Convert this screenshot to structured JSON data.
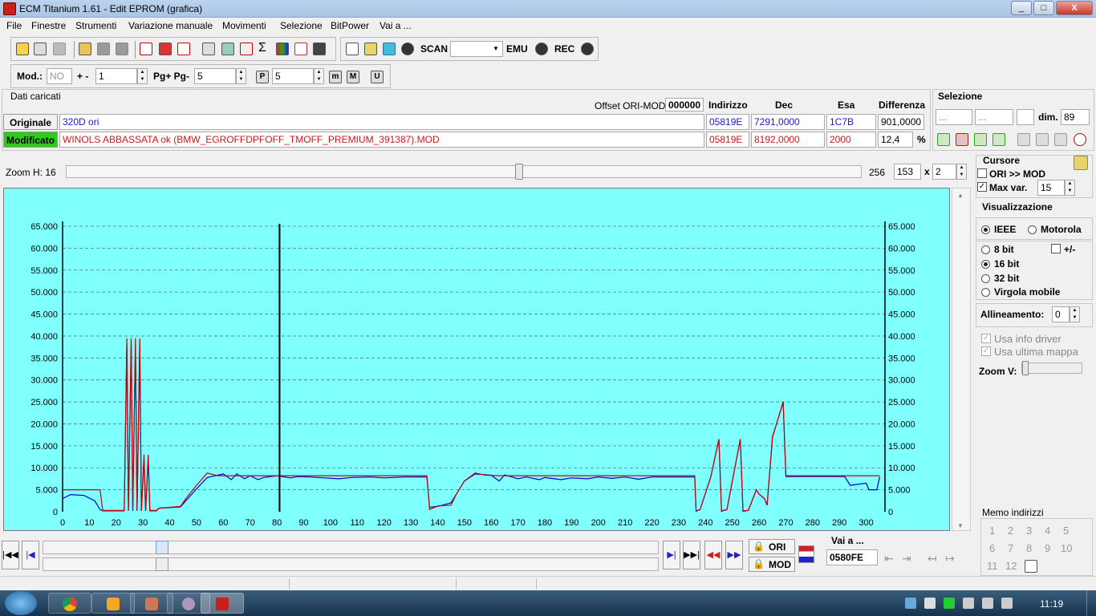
{
  "window": {
    "title": "ECM Titanium 1.61 - Edit EPROM (grafica)",
    "min": "_",
    "max": "□",
    "close": "X"
  },
  "menu": [
    "File",
    "Finestre",
    "Strumenti",
    "Variazione manuale",
    "Movimenti",
    "Selezione",
    "BitPower",
    "Vai a ..."
  ],
  "toolbar": {
    "scan": "SCAN",
    "emu": "EMU",
    "rec": "REC"
  },
  "toolbar2": {
    "mod_label": "Mod.:",
    "mod_value": "NO",
    "plusminus_label": "+ -",
    "plusminus_value": "1",
    "pg_label": "Pg+ Pg-",
    "pg_value": "5",
    "p_value": "5",
    "p_icon": "P",
    "m_icon": "m",
    "M_icon": "M",
    "U_icon": "U"
  },
  "dati": {
    "title": "Dati caricati",
    "offset_label": "Offset ORI-MOD",
    "offset_value": "000000",
    "col_indirizzo": "Indirizzo",
    "col_dec": "Dec",
    "col_esa": "Esa",
    "col_diff": "Differenza",
    "orig_label": "Originale",
    "orig_name": "320D ori",
    "orig_addr": "05819E",
    "orig_dec": "7291,0000",
    "orig_esa": "1C7B",
    "orig_diff": "901,0000",
    "mod_label": "Modificato",
    "mod_name": "WINOLS ABBASSATA ok  (BMW_EGROFFDPFOFF_TMOFF_PREMIUM_391387).MOD",
    "mod_addr": "05819E",
    "mod_dec": "8192,0000",
    "mod_esa": "2000",
    "mod_diff": "12,4",
    "pct": "%"
  },
  "selezione": {
    "title": "Selezione",
    "f1": "...",
    "f2": "...",
    "dim_label": "dim.",
    "dim_value": "89"
  },
  "zoom": {
    "label": "Zoom H: 16",
    "value": "256",
    "w": "153",
    "x": "x",
    "h": "2"
  },
  "cursore": {
    "title": "Cursore",
    "ori_mod": "ORI >> MOD",
    "max_var": "Max var.",
    "max_var_value": "15"
  },
  "visual": {
    "title": "Visualizzazione",
    "ieee": "IEEE",
    "motorola": "Motorola",
    "b8": "8 bit",
    "pm": "+/-",
    "b16": "16 bit",
    "b32": "32 bit",
    "virgola": "Virgola mobile",
    "allin_label": "Allineamento:",
    "allin_value": "0",
    "usa_info": "Usa info driver",
    "usa_ultima": "Usa ultima mappa",
    "zoomv": "Zoom V:"
  },
  "bottom": {
    "vai_label": "Vai a ...",
    "vai_value": "0580FE",
    "ori": "ORI",
    "mod": "MOD"
  },
  "memo": {
    "title": "Memo indirizzi",
    "nums": [
      "1",
      "2",
      "3",
      "4",
      "5",
      "6",
      "7",
      "8",
      "9",
      "10",
      "11",
      "12"
    ]
  },
  "clock": "11:19",
  "colors": {
    "chart_bg": "#80ffff",
    "ori": "#0000cc",
    "mod": "#cc0000",
    "status_green": "#2ecc1a"
  },
  "chart_data": {
    "type": "line",
    "x_range": [
      0,
      307
    ],
    "ylim": [
      0,
      65000
    ],
    "x_ticks": [
      "0",
      "10",
      "20",
      "30",
      "40",
      "50",
      "60",
      "70",
      "80",
      "90",
      "100",
      "110",
      "120",
      "130",
      "140",
      "150",
      "160",
      "170",
      "180",
      "190",
      "200",
      "210",
      "220",
      "230",
      "240",
      "250",
      "260",
      "270",
      "280",
      "290",
      "300"
    ],
    "y_ticks": [
      "0",
      "5.000",
      "10.000",
      "15.000",
      "20.000",
      "25.000",
      "30.000",
      "35.000",
      "40.000",
      "45.000",
      "50.000",
      "55.000",
      "60.000",
      "65.000"
    ],
    "cursor_x": 81,
    "series": [
      {
        "key": "ori",
        "points": [
          [
            0,
            3000
          ],
          [
            3,
            3900
          ],
          [
            8,
            3700
          ],
          [
            12,
            2500
          ],
          [
            14,
            500
          ],
          [
            15,
            200
          ],
          [
            22,
            200
          ],
          [
            23,
            200
          ],
          [
            24,
            38000
          ],
          [
            24.6,
            200
          ],
          [
            25.6,
            38000
          ],
          [
            26.2,
            200
          ],
          [
            27.2,
            38000
          ],
          [
            27.8,
            200
          ],
          [
            28.8,
            38000
          ],
          [
            29.4,
            200
          ],
          [
            30.4,
            12000
          ],
          [
            31,
            200
          ],
          [
            32,
            12000
          ],
          [
            32.6,
            200
          ],
          [
            35,
            200
          ],
          [
            36,
            800
          ],
          [
            44,
            1100
          ],
          [
            46,
            2500
          ],
          [
            50,
            5200
          ],
          [
            54,
            7800
          ],
          [
            60,
            8600
          ],
          [
            63,
            7300
          ],
          [
            65,
            8600
          ],
          [
            68,
            7500
          ],
          [
            70,
            8200
          ],
          [
            73,
            7300
          ],
          [
            75,
            7800
          ],
          [
            80,
            8200
          ],
          [
            85,
            7700
          ],
          [
            88,
            8000
          ],
          [
            92,
            7900
          ],
          [
            98,
            7700
          ],
          [
            103,
            7500
          ],
          [
            108,
            7800
          ],
          [
            115,
            7900
          ],
          [
            120,
            7700
          ],
          [
            128,
            7900
          ],
          [
            136,
            7900
          ],
          [
            137,
            1000
          ],
          [
            140,
            1200
          ],
          [
            145,
            2000
          ],
          [
            147,
            4000
          ],
          [
            150,
            7000
          ],
          [
            154,
            8600
          ],
          [
            160,
            8300
          ],
          [
            163,
            7000
          ],
          [
            165,
            8400
          ],
          [
            170,
            7500
          ],
          [
            173,
            7900
          ],
          [
            178,
            7300
          ],
          [
            180,
            7800
          ],
          [
            186,
            7300
          ],
          [
            190,
            7700
          ],
          [
            196,
            7500
          ],
          [
            200,
            7900
          ],
          [
            205,
            7600
          ],
          [
            210,
            7900
          ],
          [
            215,
            7400
          ],
          [
            220,
            7900
          ],
          [
            236,
            7900
          ],
          [
            236.5,
            200
          ],
          [
            238,
            500
          ],
          [
            242,
            8000
          ],
          [
            245,
            16500
          ],
          [
            246,
            200
          ],
          [
            248,
            500
          ],
          [
            253,
            16500
          ],
          [
            254,
            200
          ],
          [
            256,
            300
          ],
          [
            259,
            5000
          ],
          [
            260,
            4000
          ],
          [
            262,
            3000
          ],
          [
            263,
            1500
          ],
          [
            265,
            17000
          ],
          [
            269,
            25000
          ],
          [
            270,
            8000
          ],
          [
            292,
            8000
          ],
          [
            294,
            6000
          ],
          [
            300,
            6500
          ],
          [
            301,
            5000
          ],
          [
            304,
            5000
          ],
          [
            305,
            8000
          ]
        ]
      },
      {
        "key": "mod",
        "points": [
          [
            0,
            5000
          ],
          [
            14,
            5000
          ],
          [
            15,
            300
          ],
          [
            22,
            300
          ],
          [
            23,
            300
          ],
          [
            24,
            39500
          ],
          [
            24.6,
            300
          ],
          [
            25.6,
            39500
          ],
          [
            26.2,
            300
          ],
          [
            27.2,
            39500
          ],
          [
            27.8,
            300
          ],
          [
            28.8,
            39500
          ],
          [
            29.4,
            300
          ],
          [
            30.4,
            13000
          ],
          [
            31,
            300
          ],
          [
            32,
            13000
          ],
          [
            32.6,
            300
          ],
          [
            35,
            300
          ],
          [
            36,
            800
          ],
          [
            44,
            1200
          ],
          [
            46,
            3000
          ],
          [
            50,
            6000
          ],
          [
            54,
            8800
          ],
          [
            58,
            8200
          ],
          [
            63,
            8200
          ],
          [
            65,
            8200
          ],
          [
            70,
            8200
          ],
          [
            80,
            8200
          ],
          [
            90,
            8200
          ],
          [
            100,
            8200
          ],
          [
            110,
            8200
          ],
          [
            120,
            8200
          ],
          [
            136,
            8200
          ],
          [
            137,
            500
          ],
          [
            140,
            1300
          ],
          [
            145,
            1500
          ],
          [
            147,
            4000
          ],
          [
            150,
            7000
          ],
          [
            154,
            8800
          ],
          [
            158,
            8300
          ],
          [
            163,
            8200
          ],
          [
            170,
            8200
          ],
          [
            180,
            8200
          ],
          [
            190,
            8200
          ],
          [
            200,
            8200
          ],
          [
            210,
            8200
          ],
          [
            220,
            8200
          ],
          [
            236,
            8200
          ],
          [
            236.5,
            100
          ],
          [
            238,
            500
          ],
          [
            242,
            8000
          ],
          [
            245,
            16500
          ],
          [
            246,
            100
          ],
          [
            248,
            500
          ],
          [
            253,
            16500
          ],
          [
            254,
            100
          ],
          [
            256,
            300
          ],
          [
            259,
            5000
          ],
          [
            260,
            4000
          ],
          [
            262,
            3000
          ],
          [
            263,
            1500
          ],
          [
            265,
            17000
          ],
          [
            269,
            25000
          ],
          [
            270,
            8200
          ],
          [
            292,
            8200
          ],
          [
            294,
            8200
          ],
          [
            300,
            8200
          ],
          [
            304,
            8200
          ],
          [
            305,
            8200
          ]
        ]
      }
    ]
  }
}
